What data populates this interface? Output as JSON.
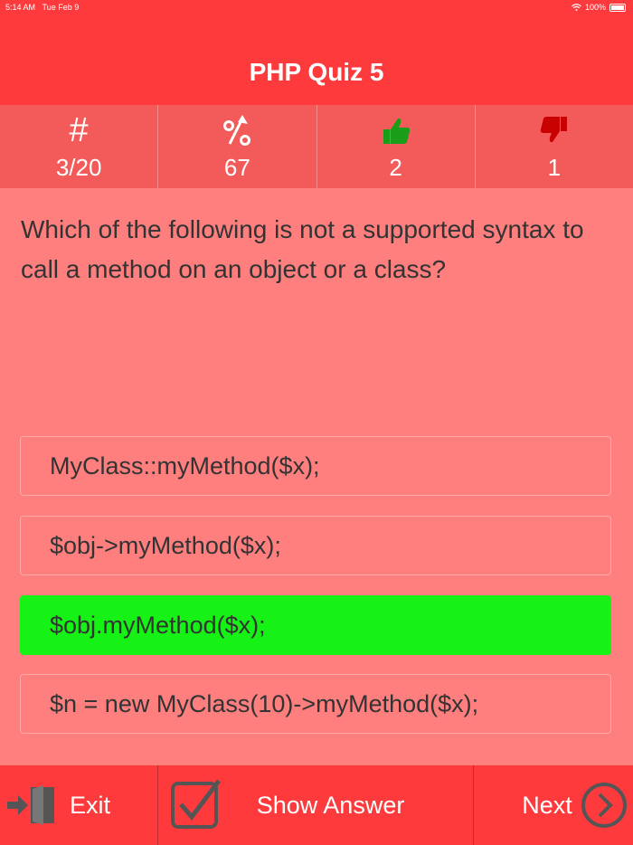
{
  "status": {
    "time": "5:14 AM",
    "date": "Tue Feb 9",
    "battery": "100%"
  },
  "header": {
    "title": "PHP Quiz 5"
  },
  "stats": {
    "question_symbol": "#",
    "question_value": "3/20",
    "percent_value": "67",
    "correct_value": "2",
    "wrong_value": "1"
  },
  "question": {
    "text": "Which of the following is not a supported syntax to call a method on an object or a class?"
  },
  "answers": [
    {
      "text": "MyClass::myMethod($x);"
    },
    {
      "text": "$obj->myMethod($x);"
    },
    {
      "text": "$obj.myMethod($x);"
    },
    {
      "text": "$n = new MyClass(10)->myMethod($x);"
    }
  ],
  "colors": {
    "header": "#ff3a3c",
    "stats": "#f25b59",
    "background": "#ff7f7f",
    "correct": "#16f216",
    "thumb_up": "#1a9e1a",
    "thumb_down": "#c80000"
  },
  "footer": {
    "exit_label": "Exit",
    "show_answer_label": "Show Answer",
    "next_label": "Next"
  }
}
